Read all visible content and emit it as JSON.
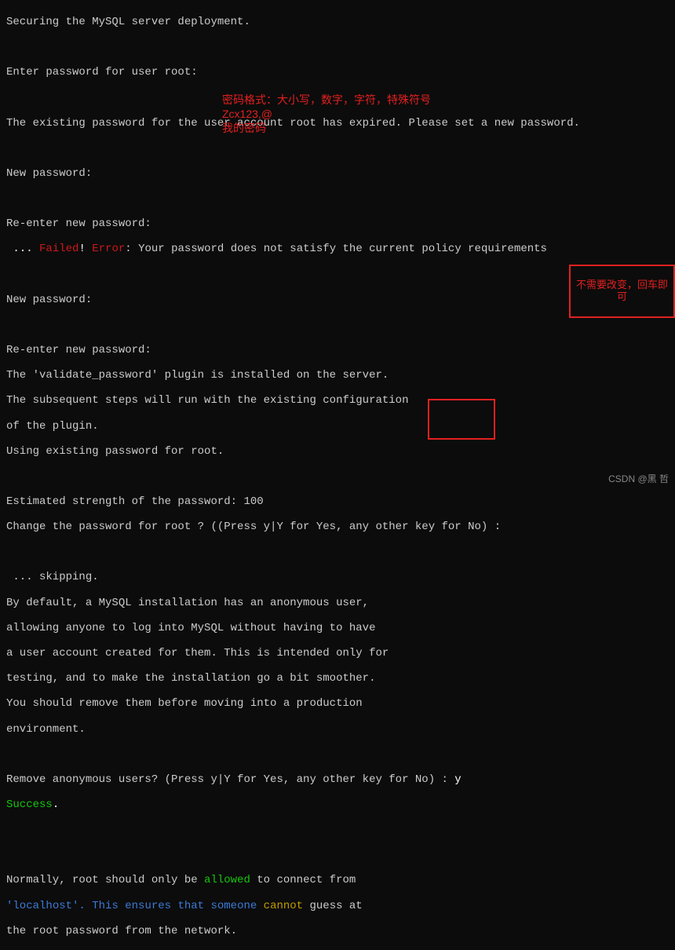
{
  "terminal": {
    "l1": "Securing the MySQL server deployment.",
    "l2": "",
    "l3": "Enter password for user root:",
    "l4": "",
    "l5": "The existing password for the user account root has expired. Please set a new password.",
    "l6": "",
    "l7": "New password:",
    "l8": "",
    "l9": "Re-enter new password:",
    "l10a": " ... ",
    "l10b": "Failed",
    "l10c": "! ",
    "l10d": "Error",
    "l10e": ": Your password does not satisfy the current policy requirements",
    "l11": "",
    "l12": "New password:",
    "l13": "",
    "l14": "Re-enter new password:",
    "l15": "The 'validate_password' plugin is installed on the server.",
    "l16": "The subsequent steps will run with the existing configuration",
    "l17": "of the plugin.",
    "l18": "Using existing password for root.",
    "l19": "",
    "l20": "Estimated strength of the password: 100",
    "l21": "Change the password for root ? ((Press y|Y for Yes, any other key for No) :",
    "l22": "",
    "l23": " ... skipping.",
    "l24": "By default, a MySQL installation has an anonymous user,",
    "l25": "allowing anyone to log into MySQL without having to have",
    "l26": "a user account created for them. This is intended only for",
    "l27": "testing, and to make the installation go a bit smoother.",
    "l28": "You should remove them before moving into a production",
    "l29": "environment.",
    "l30": "",
    "l31a": "Remove anonymous users? (Press y|Y for Yes, any other key for No) : ",
    "l31b": "y",
    "l32a": "Success",
    "l32b": ".",
    "l33": "",
    "l34": "",
    "l35a": "Normally, root should only be ",
    "l35b": "allowed",
    "l35c": " to connect from",
    "l36a": "'",
    "l36b": "localhost",
    "l36c": "'. This ensures that someone ",
    "l36d": "cannot",
    "l36e": " guess at",
    "l37": "the root password from the network."
  },
  "annotations": {
    "a1_line1": "密码格式：大小写，数字，字符，特殊符号",
    "a1_line2": "Zcx123,@",
    "a1_line3": "我的密码",
    "box_big": "不需要改变，回车即可"
  },
  "watermark": "CSDN @黑 哲"
}
